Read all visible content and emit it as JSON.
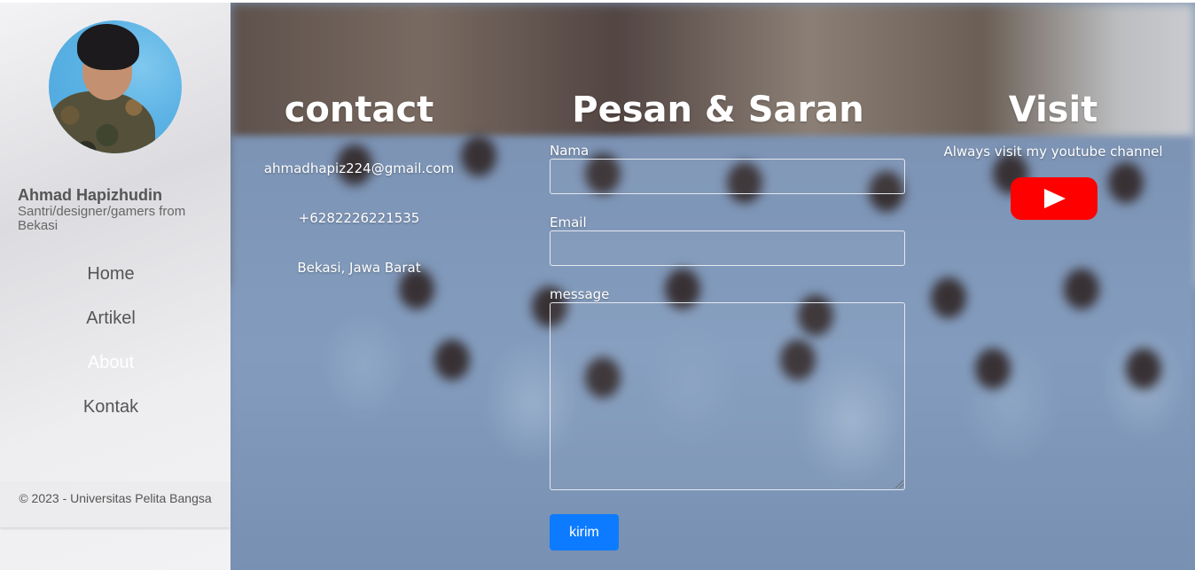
{
  "profile": {
    "name": "Ahmad Hapizhudin",
    "description": "Santri/designer/gamers from Bekasi"
  },
  "nav": {
    "items": [
      {
        "label": "Home"
      },
      {
        "label": "Artikel"
      },
      {
        "label": "About"
      },
      {
        "label": "Kontak"
      }
    ],
    "active": "About"
  },
  "footer": {
    "text": "© 2023 - Universitas Pelita Bangsa"
  },
  "contact": {
    "title": "contact",
    "email": "ahmadhapiz224@gmail.com",
    "phone": "+6282226221535",
    "location": "Bekasi, Jawa Barat"
  },
  "form": {
    "title": "Pesan & Saran",
    "name_label": "Nama",
    "name_value": "",
    "email_label": "Email",
    "email_value": "",
    "message_label": "message",
    "message_value": "",
    "submit_label": "kirim"
  },
  "visit": {
    "title": "Visit",
    "subtitle": "Always visit my youtube channel",
    "icon": "youtube-icon"
  },
  "colors": {
    "submit_button": "#0d7bff",
    "youtube_red": "#ff0000",
    "nav_text": "#555555",
    "nav_active": "#ffffff"
  }
}
